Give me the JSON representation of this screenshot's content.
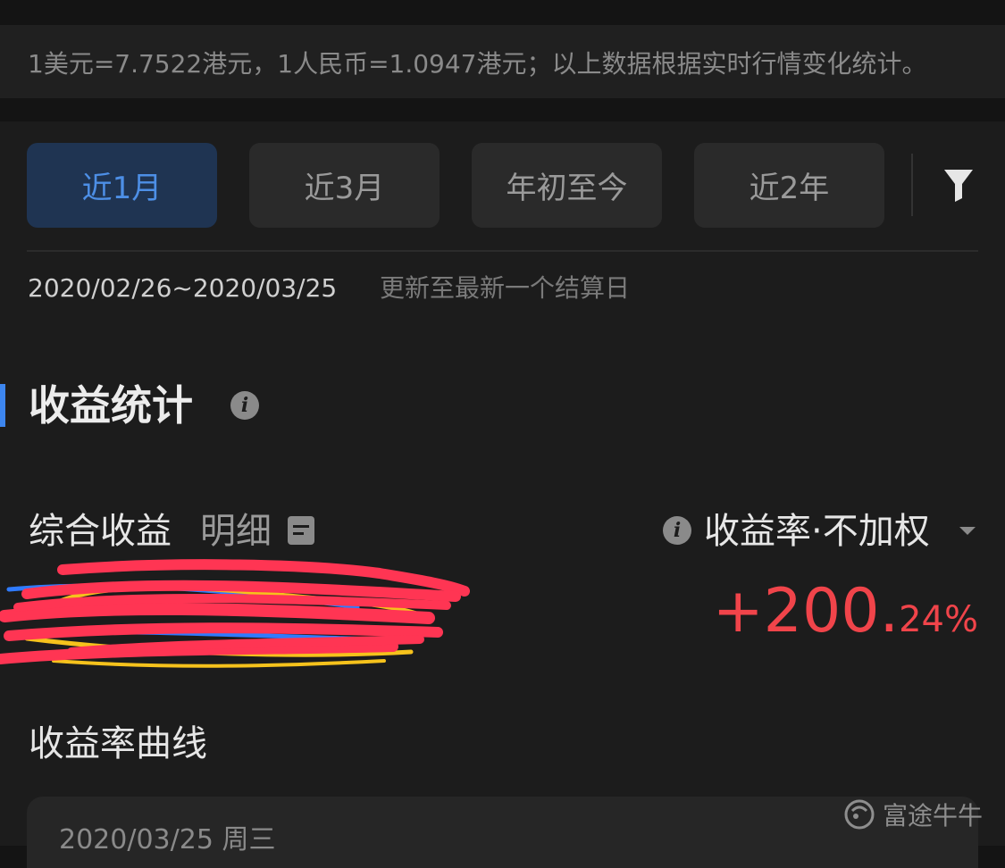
{
  "exchange_note": "1美元=7.7522港元，1人民币=1.0947港元；以上数据根据实时行情变化统计。",
  "tabs": [
    {
      "label": "近1月",
      "active": true
    },
    {
      "label": "近3月",
      "active": false
    },
    {
      "label": "年初至今",
      "active": false
    },
    {
      "label": "近2年",
      "active": false
    }
  ],
  "date_range": "2020/02/26~2020/03/25",
  "update_note": "更新至最新一个结算日",
  "section": {
    "title": "收益统计"
  },
  "summary": {
    "label": "综合收益",
    "detail_label": "明细",
    "metric_selector": "收益率·不加权",
    "return_sign_int": "+200.",
    "return_decimals": "24%"
  },
  "chart": {
    "title": "收益率曲线",
    "date_label": "2020/03/25   周三"
  },
  "watermark": "富途牛牛",
  "colors": {
    "accent": "#3d86ef",
    "positive": "#f0444a",
    "active_tab_bg": "#1f3452"
  }
}
